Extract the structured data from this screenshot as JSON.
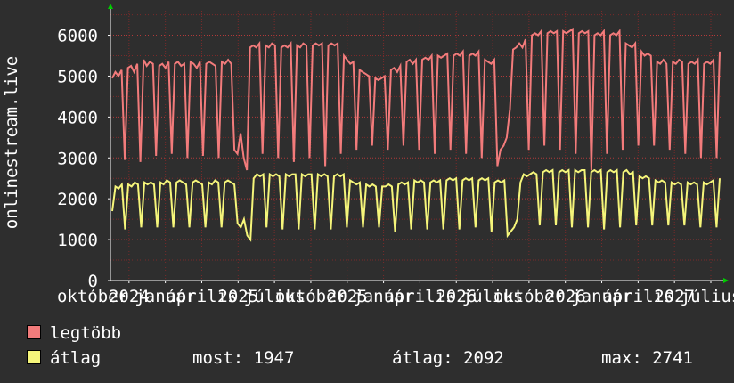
{
  "chart_data": {
    "type": "line",
    "ylabel": "onlinestream.live",
    "ylim": [
      0,
      6600
    ],
    "y_ticks": [
      0,
      1000,
      2000,
      3000,
      4000,
      5000,
      6000
    ],
    "x_ticks": [
      "október",
      "2024",
      "január",
      "április",
      "2025",
      "július",
      "október",
      "2025",
      "január",
      "április",
      "2026",
      "július",
      "október",
      "2026",
      "január",
      "április",
      "2027",
      "július"
    ],
    "colors": {
      "background": "#2e2e2e",
      "grid": "#7a2a2a",
      "legtobb": "#f27b7b",
      "atlag": "#f5f57a",
      "axis_arrow": "#00cc00"
    },
    "series": [
      {
        "name": "legtöbb",
        "color": "#f27b7b",
        "values": [
          4950,
          5100,
          5000,
          5150,
          2950,
          5200,
          5250,
          5100,
          5300,
          2900,
          5400,
          5250,
          5350,
          5300,
          3050,
          5250,
          5300,
          5200,
          5350,
          3100,
          5300,
          5350,
          5250,
          5300,
          3000,
          5350,
          5300,
          5200,
          5350,
          3050,
          5300,
          5350,
          5300,
          5250,
          3000,
          5350,
          5300,
          5400,
          5300,
          3200,
          3100,
          3600,
          3000,
          2700,
          5700,
          5750,
          5700,
          5800,
          3100,
          5750,
          5700,
          5800,
          5750,
          3000,
          5700,
          5750,
          5700,
          5800,
          2900,
          5750,
          5700,
          5800,
          5750,
          3000,
          5750,
          5800,
          5750,
          5800,
          2800,
          5750,
          5800,
          5750,
          5800,
          3100,
          5500,
          5400,
          5300,
          5350,
          3200,
          5150,
          5100,
          5050,
          5000,
          3300,
          4950,
          4900,
          4950,
          5000,
          3200,
          5150,
          5200,
          5100,
          5250,
          3300,
          5350,
          5400,
          5300,
          5400,
          3200,
          5400,
          5450,
          5400,
          5500,
          3100,
          5500,
          5450,
          5500,
          5550,
          3200,
          5500,
          5550,
          5500,
          5600,
          3100,
          5500,
          5550,
          5500,
          5600,
          3000,
          5400,
          5350,
          5300,
          5400,
          2800,
          3200,
          3300,
          3500,
          4200,
          5650,
          5700,
          5800,
          5700,
          5900,
          3200,
          6000,
          6050,
          6000,
          6100,
          3300,
          6050,
          6100,
          6050,
          6100,
          3200,
          6100,
          6050,
          6100,
          6150,
          3100,
          6050,
          6100,
          6050,
          6100,
          2700,
          6000,
          6050,
          6000,
          6100,
          3100,
          6000,
          6050,
          6000,
          6100,
          3200,
          5800,
          5750,
          5700,
          5800,
          3300,
          5600,
          5500,
          5550,
          5500,
          3300,
          5350,
          5300,
          5400,
          5300,
          3200,
          5350,
          5300,
          5400,
          5350,
          3100,
          5300,
          5350,
          5300,
          5400,
          3000,
          5300,
          5350,
          5300,
          5400,
          3000,
          5600
        ]
      },
      {
        "name": "átlag",
        "color": "#f5f57a",
        "values": [
          1700,
          2300,
          2250,
          2350,
          1250,
          2350,
          2300,
          2400,
          2350,
          1300,
          2400,
          2350,
          2400,
          2350,
          1300,
          2400,
          2350,
          2450,
          2400,
          1300,
          2400,
          2450,
          2400,
          2350,
          1300,
          2400,
          2450,
          2400,
          2350,
          1300,
          2400,
          2350,
          2450,
          2400,
          1300,
          2400,
          2450,
          2400,
          2350,
          1400,
          1300,
          1500,
          1100,
          1000,
          2500,
          2600,
          2550,
          2600,
          1300,
          2600,
          2550,
          2600,
          2550,
          1250,
          2600,
          2550,
          2600,
          2600,
          1250,
          2600,
          2550,
          2600,
          2600,
          1250,
          2600,
          2550,
          2600,
          2550,
          1250,
          2550,
          2600,
          2550,
          2600,
          1300,
          2450,
          2400,
          2350,
          2400,
          1300,
          2350,
          2300,
          2350,
          2300,
          1300,
          2300,
          2300,
          2350,
          2300,
          1200,
          2350,
          2400,
          2350,
          2400,
          1250,
          2450,
          2400,
          2450,
          2400,
          1250,
          2400,
          2450,
          2400,
          2450,
          1250,
          2450,
          2500,
          2450,
          2500,
          1250,
          2450,
          2500,
          2450,
          2500,
          1300,
          2450,
          2500,
          2450,
          2500,
          1200,
          2400,
          2450,
          2400,
          2450,
          1100,
          1200,
          1300,
          1500,
          2400,
          2600,
          2550,
          2600,
          2650,
          2600,
          1350,
          2650,
          2700,
          2650,
          2700,
          1350,
          2650,
          2700,
          2650,
          2700,
          1300,
          2700,
          2650,
          2700,
          2700,
          1300,
          2650,
          2700,
          2650,
          2700,
          1250,
          2650,
          2700,
          2650,
          2700,
          1300,
          2650,
          2700,
          2600,
          2650,
          1350,
          2550,
          2500,
          2550,
          2500,
          1350,
          2450,
          2400,
          2450,
          2400,
          1350,
          2400,
          2350,
          2400,
          2350,
          1350,
          2400,
          2350,
          2400,
          2350,
          1300,
          2400,
          2350,
          2400,
          2450,
          1300,
          2500
        ]
      }
    ]
  },
  "legend": [
    {
      "label": "legtöbb",
      "color": "#f27b7b"
    },
    {
      "label": "átlag",
      "color": "#f5f57a"
    }
  ],
  "stats": {
    "now": "most: 1947",
    "avg": "átlag: 2092",
    "max": "max: 2741"
  }
}
